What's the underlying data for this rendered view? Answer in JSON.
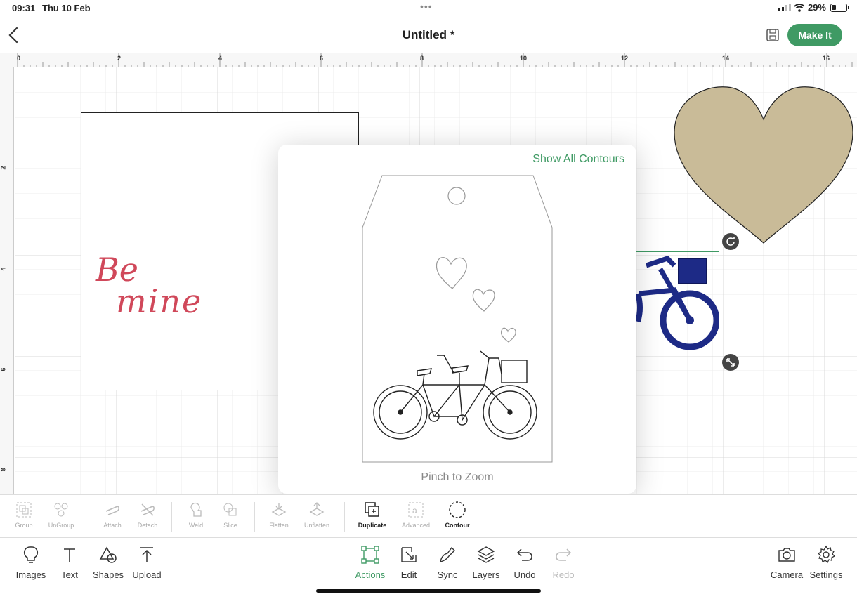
{
  "status_bar": {
    "time": "09:31",
    "date": "Thu 10 Feb",
    "battery": "29%"
  },
  "header": {
    "title": "Untitled *",
    "make_it_label": "Make It"
  },
  "ruler": {
    "top_labels": [
      "0",
      "2",
      "4",
      "6",
      "8",
      "10",
      "12",
      "14",
      "16"
    ],
    "left_labels": [
      "2",
      "4",
      "6",
      "8"
    ]
  },
  "canvas": {
    "card_text_line1": "Be",
    "card_text_line2": "mine"
  },
  "contour_popover": {
    "show_all_label": "Show All Contours",
    "hint": "Pinch to Zoom"
  },
  "colors": {
    "accent": "#3f9a64",
    "heart": "#c9bb98",
    "bike": "#1d2a86",
    "script_text": "#d0485a"
  },
  "action_bar": [
    {
      "label": "Group",
      "enabled": false
    },
    {
      "label": "UnGroup",
      "enabled": false
    },
    {
      "label": "Attach",
      "enabled": false
    },
    {
      "label": "Detach",
      "enabled": false
    },
    {
      "label": "Weld",
      "enabled": false
    },
    {
      "label": "Slice",
      "enabled": false
    },
    {
      "label": "Flatten",
      "enabled": false
    },
    {
      "label": "Unflatten",
      "enabled": false
    },
    {
      "label": "Duplicate",
      "enabled": true
    },
    {
      "label": "Advanced",
      "enabled": false
    },
    {
      "label": "Contour",
      "enabled": true
    }
  ],
  "bottom_bar": {
    "images": "Images",
    "text": "Text",
    "shapes": "Shapes",
    "upload": "Upload",
    "actions": "Actions",
    "edit": "Edit",
    "sync": "Sync",
    "layers": "Layers",
    "undo": "Undo",
    "redo": "Redo",
    "camera": "Camera",
    "settings": "Settings"
  }
}
